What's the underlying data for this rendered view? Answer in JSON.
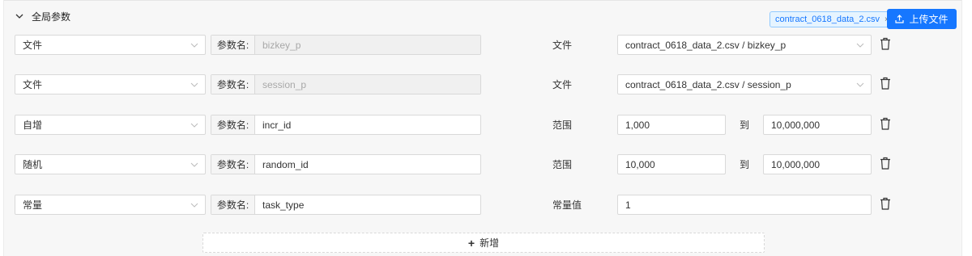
{
  "header": {
    "title": "全局参数"
  },
  "upload": {
    "file_tag": "contract_0618_data_2.csv",
    "file_tag_close": "×",
    "button_label": "上传文件"
  },
  "param_prefix": "参数名:",
  "rows": [
    {
      "type": "文件",
      "name": "bizkey_p",
      "disabled": true,
      "label": "文件",
      "value": "contract_0618_data_2.csv / bizkey_p"
    },
    {
      "type": "文件",
      "name": "session_p",
      "disabled": true,
      "label": "文件",
      "value": "contract_0618_data_2.csv / session_p"
    },
    {
      "type": "自增",
      "name": "incr_id",
      "disabled": false,
      "label": "范围",
      "from": "1,000",
      "to_label": "到",
      "to": "10,000,000"
    },
    {
      "type": "随机",
      "name": "random_id",
      "disabled": false,
      "label": "范围",
      "from": "10,000",
      "to_label": "到",
      "to": "10,000,000"
    },
    {
      "type": "常量",
      "name": "task_type",
      "disabled": false,
      "label": "常量值",
      "value": "1"
    }
  ],
  "add_button": {
    "label": "新增",
    "icon": "+"
  },
  "colors": {
    "primary": "#1677ff",
    "tag_bg": "#e6f4ff",
    "panel_bg": "#f7f7f7"
  }
}
